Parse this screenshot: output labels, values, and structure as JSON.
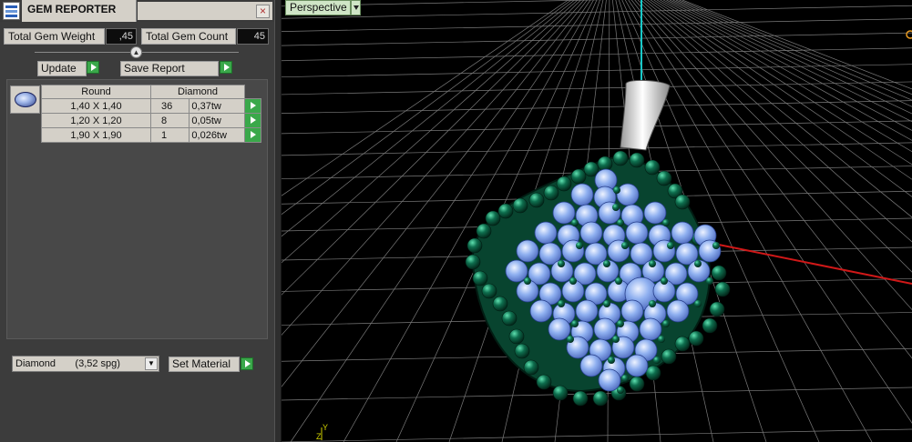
{
  "window": {
    "title": "GEM REPORTER",
    "close_glyph": "×"
  },
  "totals": {
    "weight_label": "Total Gem Weight",
    "weight_value": ",45",
    "count_label": "Total Gem Count",
    "count_value": "45"
  },
  "actions": {
    "update_label": "Update",
    "save_report_label": "Save Report",
    "set_material_label": "Set Material"
  },
  "gem_table": {
    "cut": "Round",
    "material": "Diamond",
    "rows": [
      {
        "size": "1,40 X 1,40",
        "count": "36",
        "weight": "0,37tw"
      },
      {
        "size": "1,20 X 1,20",
        "count": "8",
        "weight": "0,05tw"
      },
      {
        "size": "1,90 X 1,90",
        "count": "1",
        "weight": "0,026tw"
      }
    ]
  },
  "material_select": {
    "selected": "Diamond       (3,52 spg)"
  },
  "viewport": {
    "view_name": "Perspective",
    "axis_y_label": "Y",
    "axis_z_label": "Z"
  },
  "colors": {
    "panel_bg": "#3c3c3c",
    "grid": "#7a7a7a",
    "x_axis": "#d01818",
    "y_axis": "#18c8c8",
    "prong_green": "#0e6e4e",
    "stone_blue": "#8fb0f0"
  }
}
